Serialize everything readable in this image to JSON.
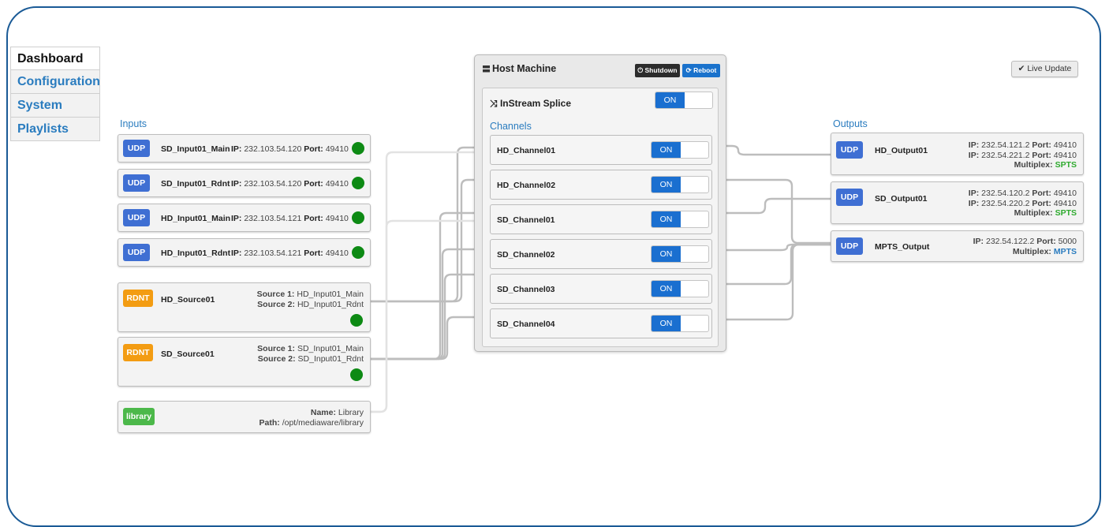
{
  "nav": {
    "items": [
      {
        "label": "Dashboard",
        "active": true
      },
      {
        "label": "Configuration",
        "active": false
      },
      {
        "label": "System",
        "active": false
      },
      {
        "label": "Playlists",
        "active": false
      }
    ]
  },
  "sections": {
    "inputs": "Inputs",
    "outputs": "Outputs",
    "channels": "Channels"
  },
  "colors": {
    "accent": "#2a7cbf",
    "udp": "#3f6fd3",
    "rdnt": "#f39c12",
    "library": "#4cb84a",
    "status_ok": "#0d8a14",
    "toggle_on": "#1a6fd0"
  },
  "ip_label": "IP:",
  "port_label": "Port:",
  "inputs": [
    {
      "tag": "UDP",
      "name": "SD_Input01_Main",
      "ip": "232.103.54.120",
      "port": "49410"
    },
    {
      "tag": "UDP",
      "name": "SD_Input01_Rdnt",
      "ip": "232.103.54.120",
      "port": "49410"
    },
    {
      "tag": "UDP",
      "name": "HD_Input01_Main",
      "ip": "232.103.54.121",
      "port": "49410"
    },
    {
      "tag": "UDP",
      "name": "HD_Input01_Rdnt",
      "ip": "232.103.54.121",
      "port": "49410"
    }
  ],
  "sources": [
    {
      "tag": "RDNT",
      "name": "HD_Source01",
      "source1_label": "Source 1:",
      "source1": "HD_Input01_Main",
      "source2_label": "Source 2:",
      "source2": "HD_Input01_Rdnt"
    },
    {
      "tag": "RDNT",
      "name": "SD_Source01",
      "source1_label": "Source 1:",
      "source1": "SD_Input01_Main",
      "source2_label": "Source 2:",
      "source2": "SD_Input01_Rdnt"
    }
  ],
  "library": {
    "tag": "library",
    "name_label": "Name:",
    "name": "Library",
    "path_label": "Path:",
    "path": "/opt/mediaware/library"
  },
  "host": {
    "title": "Host Machine",
    "shutdown": "Shutdown",
    "reboot": "Reboot",
    "splice_label": "InStream Splice",
    "splice_state": "ON",
    "channels": [
      {
        "name": "HD_Channel01",
        "state": "ON"
      },
      {
        "name": "HD_Channel02",
        "state": "ON"
      },
      {
        "name": "SD_Channel01",
        "state": "ON"
      },
      {
        "name": "SD_Channel02",
        "state": "ON"
      },
      {
        "name": "SD_Channel03",
        "state": "ON"
      },
      {
        "name": "SD_Channel04",
        "state": "ON"
      }
    ]
  },
  "live_update": "Live Update",
  "outputs": [
    {
      "tag": "UDP",
      "name": "HD_Output01",
      "ip1": "232.54.121.2",
      "port1": "49410",
      "ip2": "232.54.221.2",
      "port2": "49410",
      "multiplex_label": "Multiplex:",
      "multiplex": "SPTS"
    },
    {
      "tag": "UDP",
      "name": "SD_Output01",
      "ip1": "232.54.120.2",
      "port1": "49410",
      "ip2": "232.54.220.2",
      "port2": "49410",
      "multiplex_label": "Multiplex:",
      "multiplex": "SPTS"
    },
    {
      "tag": "UDP",
      "name": "MPTS_Output",
      "ip1": "232.54.122.2",
      "port1": "5000",
      "multiplex_label": "Multiplex:",
      "multiplex": "MPTS"
    }
  ]
}
